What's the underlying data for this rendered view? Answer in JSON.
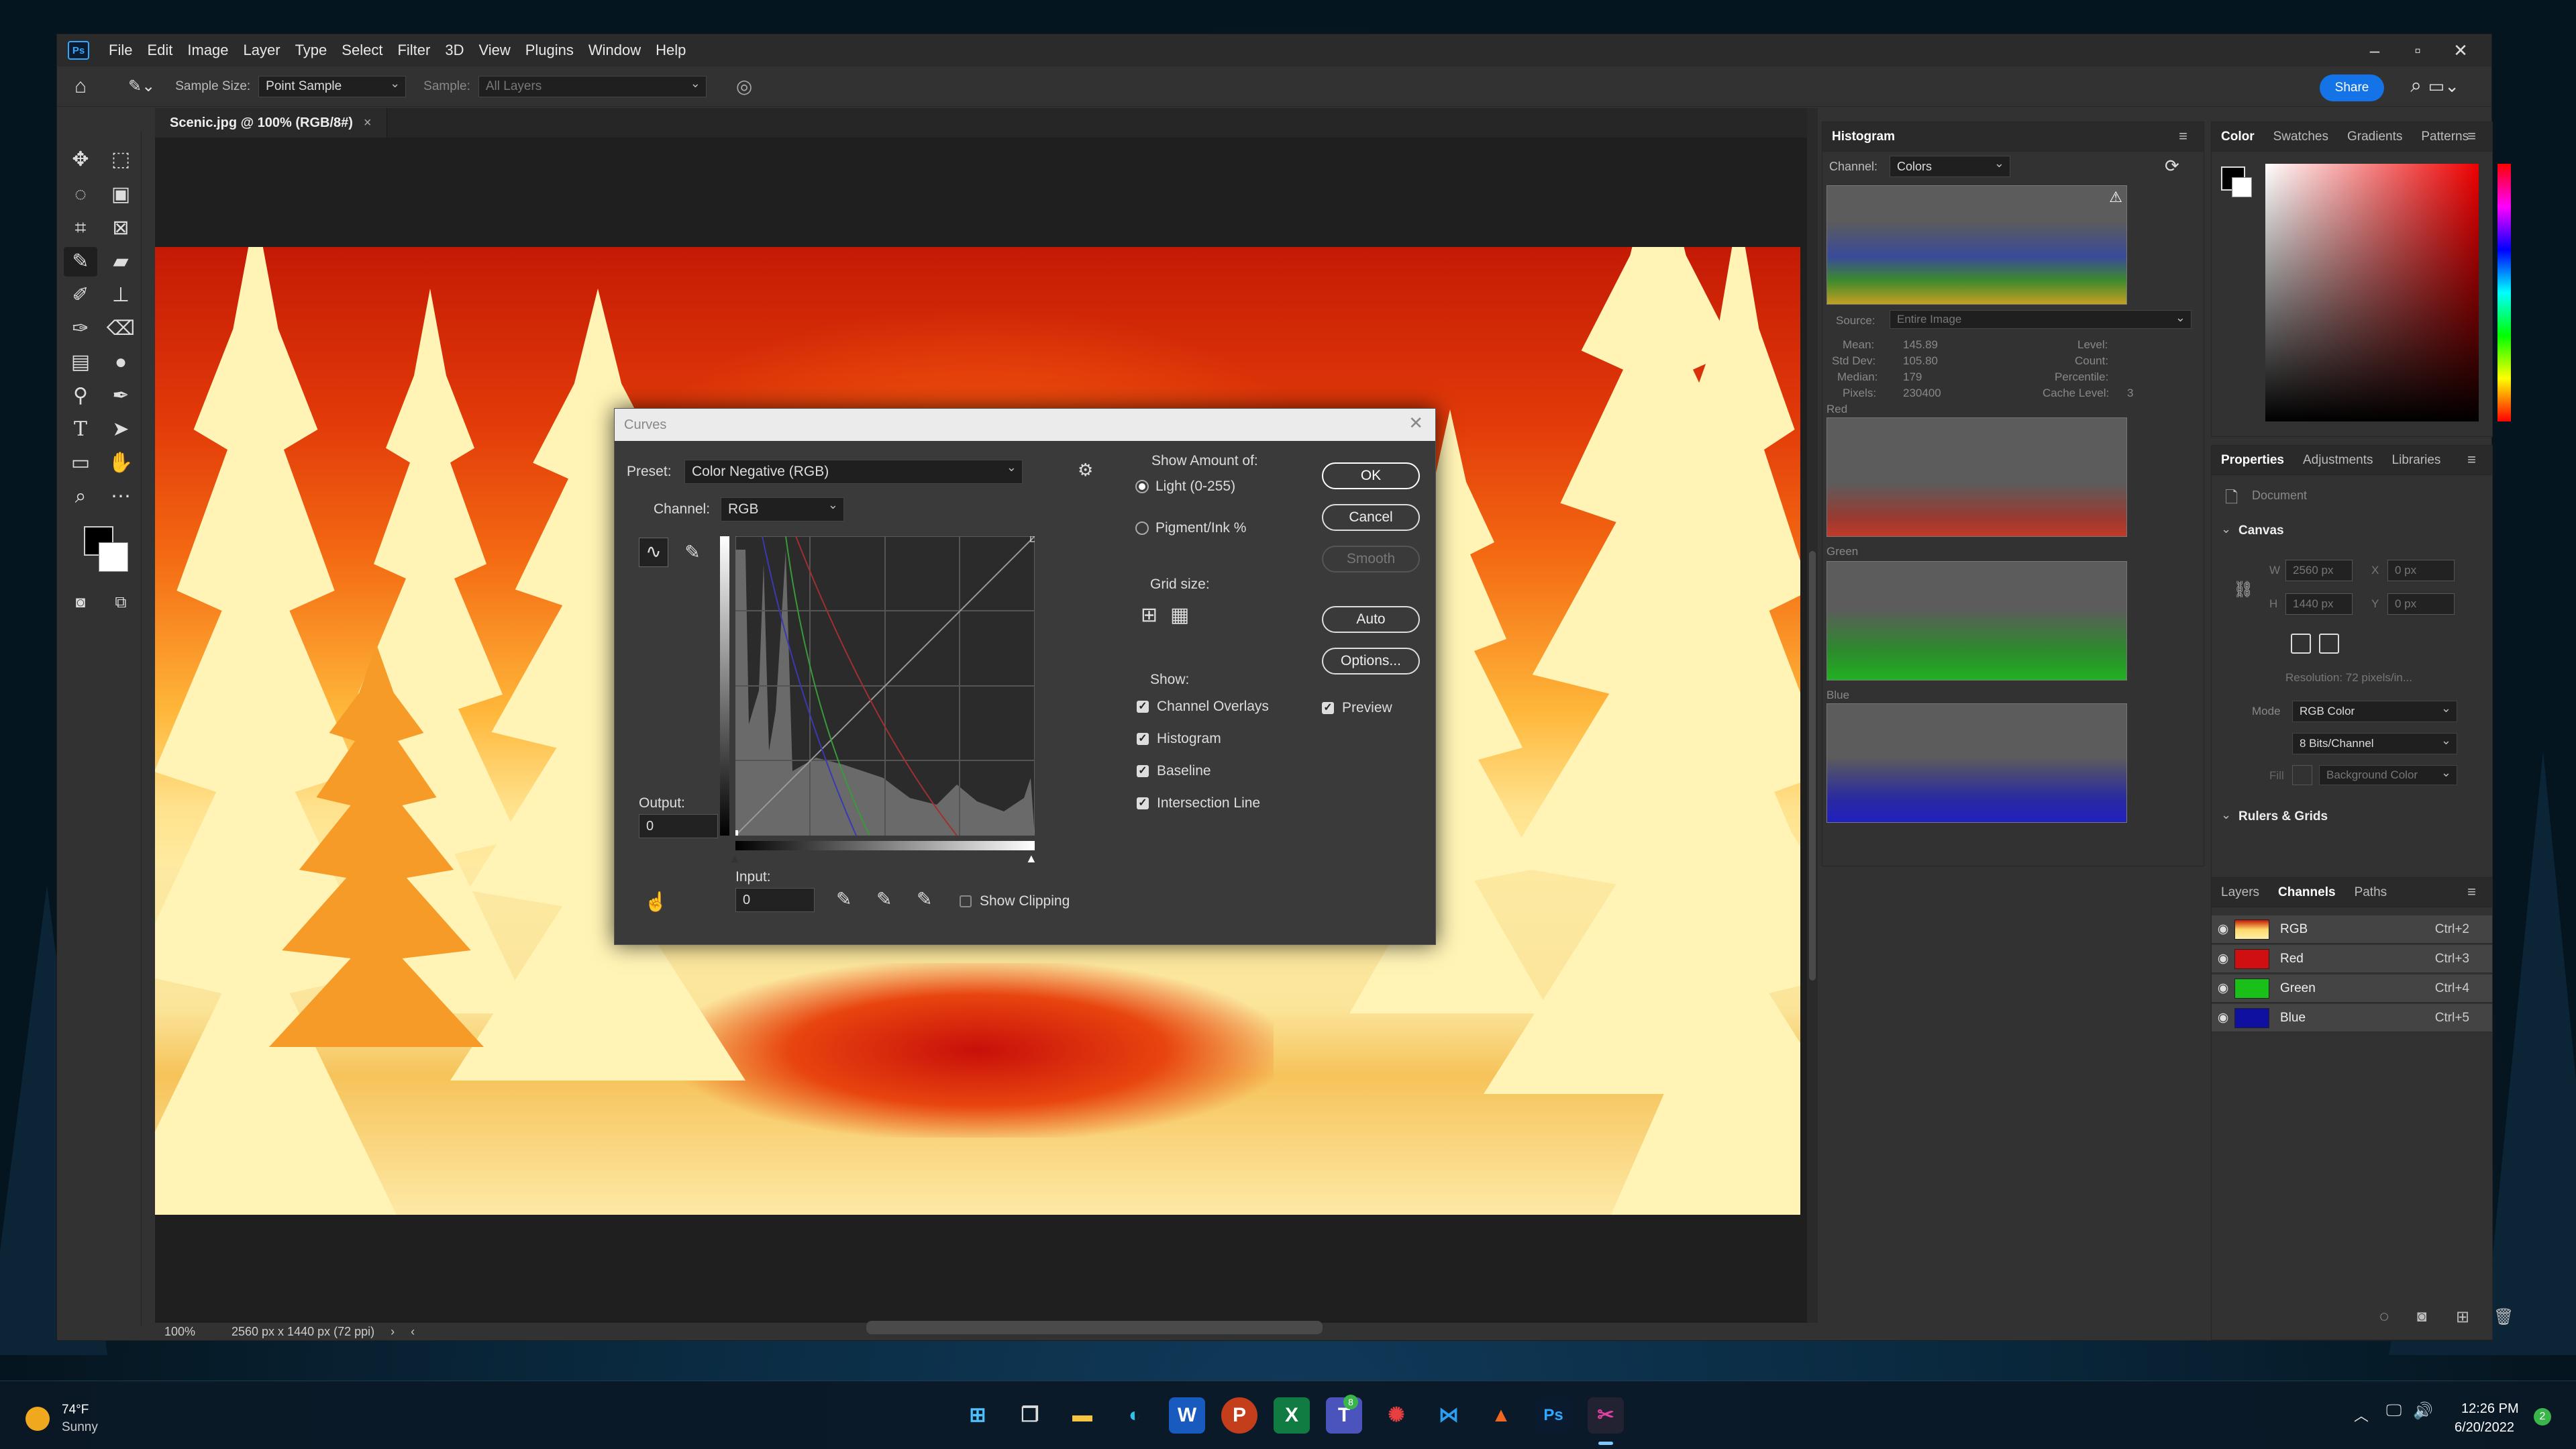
{
  "app": {
    "title": "Adobe Photoshop",
    "logo": "Ps",
    "menus": [
      "File",
      "Edit",
      "Image",
      "Layer",
      "Type",
      "Select",
      "Filter",
      "3D",
      "View",
      "Plugins",
      "Window",
      "Help"
    ]
  },
  "options_bar": {
    "sample_size_label": "Sample Size:",
    "sample_size_value": "Point Sample",
    "sample_label": "Sample:",
    "sample_value": "All Layers",
    "share_label": "Share"
  },
  "document": {
    "tab_title": "Scenic.jpg @ 100% (RGB/8#)",
    "tab_close": "×",
    "zoom": "100%",
    "dimensions": "2560 px x 1440 px (72 ppi)",
    "status_arrow": "›",
    "status_left": "‹"
  },
  "curves_dialog": {
    "title": "Curves",
    "preset_label": "Preset:",
    "preset_value": "Color Negative (RGB)",
    "channel_label": "Channel:",
    "channel_value": "RGB",
    "output_label": "Output:",
    "output_value": "0",
    "input_label": "Input:",
    "input_value": "0",
    "show_clipping_label": "Show Clipping",
    "show_amount_label": "Show Amount of:",
    "light_label": "Light  (0-255)",
    "pigment_label": "Pigment/Ink %",
    "grid_size_label": "Grid size:",
    "show_label": "Show:",
    "show_options": [
      "Channel Overlays",
      "Histogram",
      "Baseline",
      "Intersection Line"
    ],
    "buttons": {
      "ok": "OK",
      "cancel": "Cancel",
      "smooth": "Smooth",
      "auto": "Auto",
      "options": "Options..."
    },
    "preview_label": "Preview"
  },
  "histogram_panel": {
    "tab": "Histogram",
    "channel_label": "Channel:",
    "channel_value": "Colors",
    "source_label": "Source:",
    "source_value": "Entire Image",
    "stats": [
      [
        "Mean:",
        "145.89"
      ],
      [
        "Std Dev:",
        "105.80"
      ],
      [
        "Median:",
        "179"
      ],
      [
        "Pixels:",
        "230400"
      ]
    ],
    "stats_right": [
      "Level:",
      "Count:",
      "Percentile:",
      "Cache Level:"
    ],
    "cache_level": "3",
    "channels": [
      "Red",
      "Green",
      "Blue"
    ]
  },
  "color_panel": {
    "tabs": [
      "Color",
      "Swatches",
      "Gradients",
      "Patterns"
    ]
  },
  "properties_panel": {
    "tabs": [
      "Properties",
      "Adjustments",
      "Libraries"
    ],
    "document_label": "Document",
    "canvas_section": "Canvas",
    "w_label": "W",
    "w_value": "2560 px",
    "h_label": "H",
    "h_value": "1440 px",
    "x_label": "X",
    "x_value": "0 px",
    "y_label": "Y",
    "y_value": "0 px",
    "resolution": "Resolution:  72  pixels/in...",
    "mode_label": "Mode",
    "mode_value": "RGB Color",
    "depth_value": "8 Bits/Channel",
    "fill_label": "Fill",
    "fill_value": "Background Color",
    "rulers_section": "Rulers & Grids"
  },
  "channels_panel": {
    "tabs": [
      "Layers",
      "Channels",
      "Paths"
    ],
    "rows": [
      {
        "name": "RGB",
        "shortcut": "Ctrl+2"
      },
      {
        "name": "Red",
        "shortcut": "Ctrl+3"
      },
      {
        "name": "Green",
        "shortcut": "Ctrl+4"
      },
      {
        "name": "Blue",
        "shortcut": "Ctrl+5"
      }
    ]
  },
  "taskbar": {
    "weather_temp": "74°F",
    "weather_cond": "Sunny",
    "time": "12:26 PM",
    "date": "6/20/2022",
    "notif_count": "2",
    "teams_badge": "8",
    "apps": [
      "windows-start-icon",
      "task-view-icon",
      "file-explorer-icon",
      "edge-icon",
      "word-icon",
      "powerpoint-icon",
      "excel-icon",
      "teams-icon",
      "settings-icon",
      "vscode-icon",
      "matlab-icon",
      "photoshop-icon",
      "snipping-icon"
    ]
  },
  "colors": {
    "accent": "#1473e6",
    "ps_blue": "#31a8ff"
  }
}
